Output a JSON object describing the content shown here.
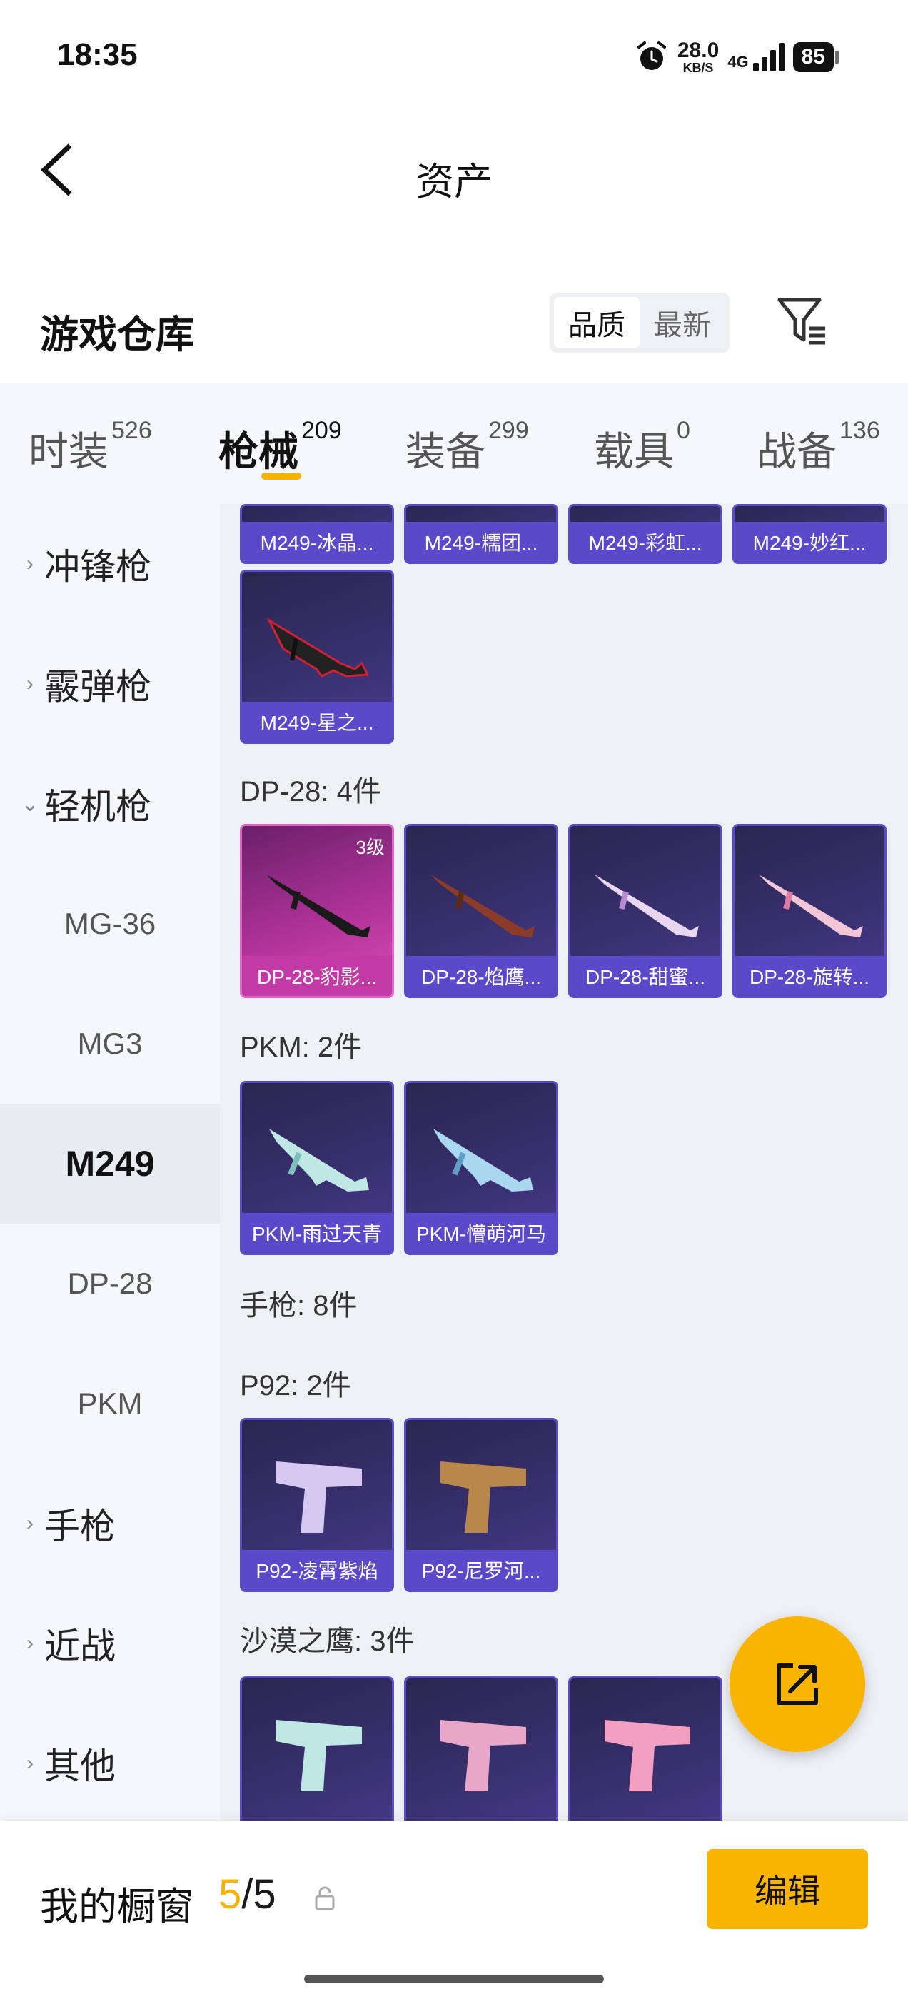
{
  "status": {
    "time": "18:35",
    "net_speed": "28.0",
    "net_unit": "KB/S",
    "network": "4G",
    "battery": "85"
  },
  "header": {
    "title": "资产"
  },
  "warehouse": {
    "title": "游戏仓库",
    "sort_options": [
      "品质",
      "最新"
    ],
    "selected_sort": "品质"
  },
  "tabs": [
    {
      "label": "时装",
      "count": "526"
    },
    {
      "label": "枪械",
      "count": "209"
    },
    {
      "label": "装备",
      "count": "299"
    },
    {
      "label": "载具",
      "count": "0"
    },
    {
      "label": "战备",
      "count": "136"
    }
  ],
  "active_tab": "枪械",
  "sidebar": {
    "categories": [
      "冲锋枪",
      "霰弹枪",
      "轻机枪",
      "手枪",
      "近战",
      "其他"
    ],
    "subitems": [
      "MG-36",
      "MG3",
      "M249",
      "DP-28",
      "PKM"
    ],
    "selected": "M249"
  },
  "content": {
    "m249_partial": [
      "M249-冰晶...",
      "M249-糯团...",
      "M249-彩虹...",
      "M249-妙红..."
    ],
    "m249_more": [
      "M249-星之..."
    ],
    "dp28_header": "DP-28: 4件",
    "dp28": [
      {
        "name": "DP-28-豹影...",
        "level": "3级"
      },
      {
        "name": "DP-28-焰鹰..."
      },
      {
        "name": "DP-28-甜蜜..."
      },
      {
        "name": "DP-28-旋转..."
      }
    ],
    "pkm_header": "PKM: 2件",
    "pkm": [
      "PKM-雨过天青",
      "PKM-懵萌河马"
    ],
    "pistol_header": "手枪: 8件",
    "p92_header": "P92: 2件",
    "p92": [
      "P92-凌霄紫焰",
      "P92-尼罗河..."
    ],
    "deagle_header": "沙漠之鹰: 3件"
  },
  "bottom": {
    "label": "我的橱窗",
    "count_current": "5",
    "count_sep": "/",
    "count_total": "5",
    "edit_label": "编辑"
  },
  "colors": {
    "accent": "#f8b400",
    "card_purple": "#5a49c8",
    "card_pink": "#c23aa6"
  }
}
